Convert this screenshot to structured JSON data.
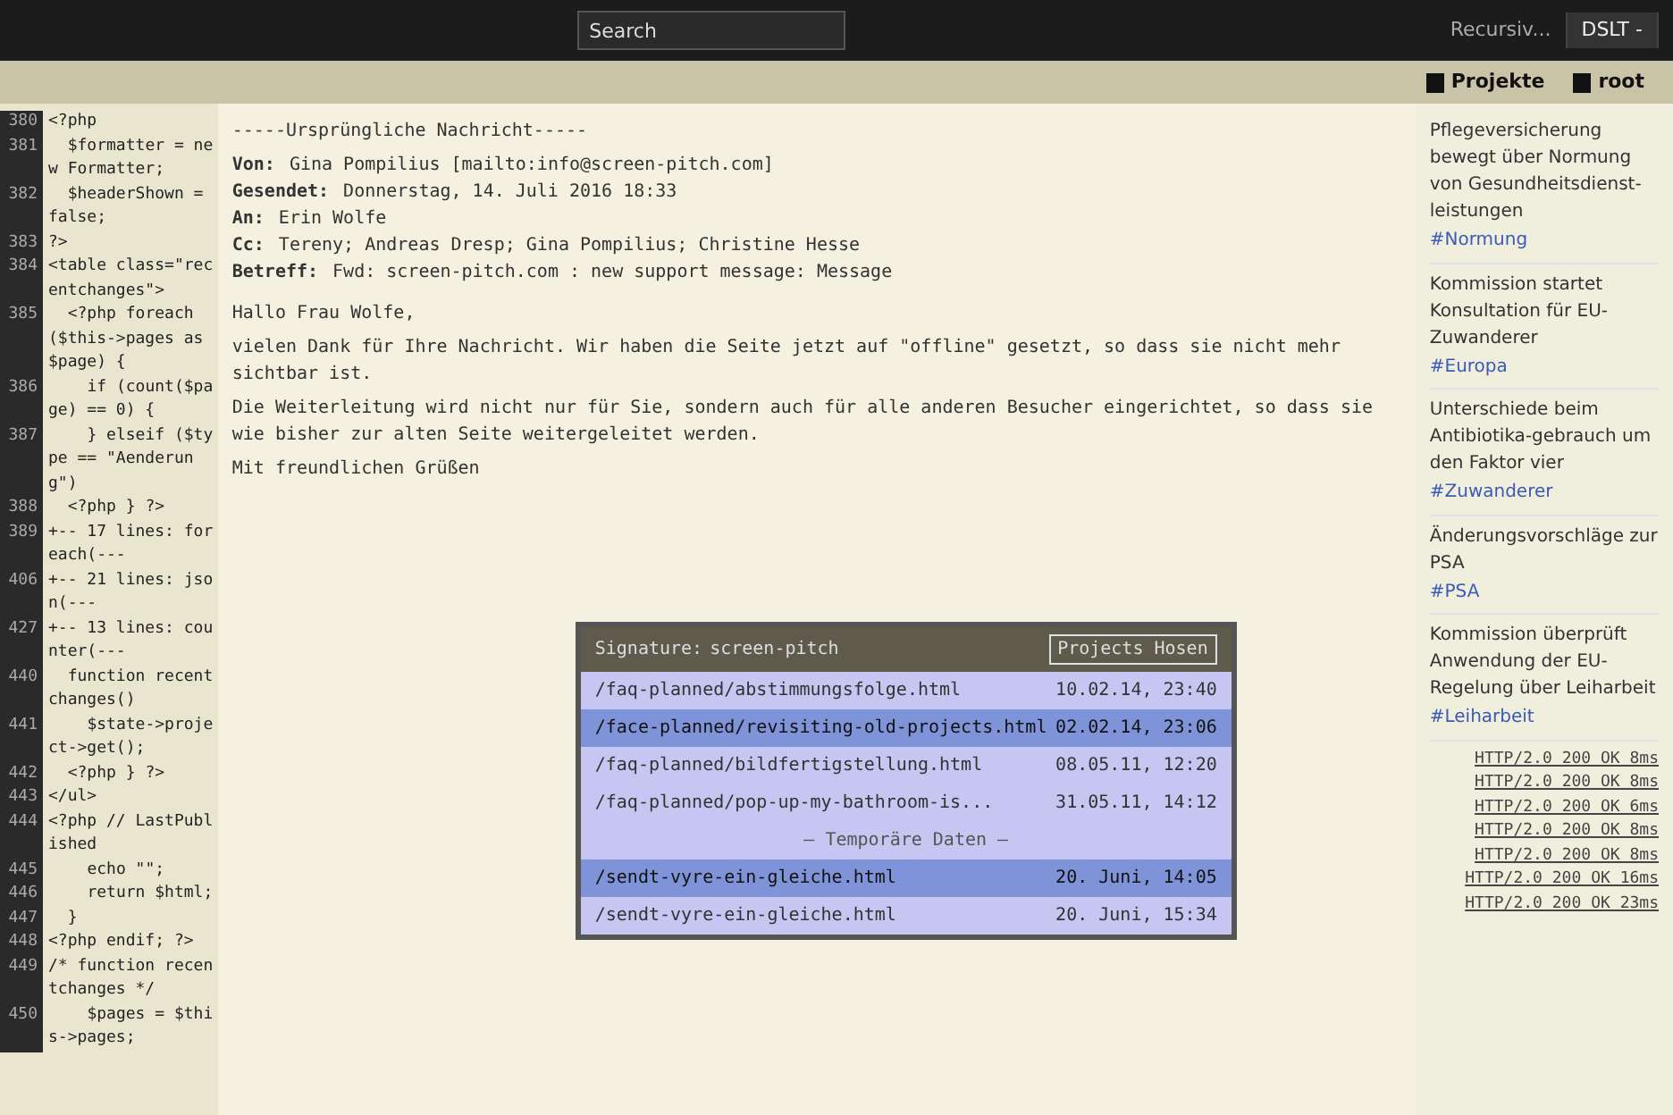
{
  "browser": {
    "tabs": [
      {
        "label": "Recursiv...",
        "selected": false
      },
      {
        "label": "DSLT -",
        "selected": true
      }
    ],
    "search": {
      "placeholder": "Search"
    },
    "bookmarks": [
      {
        "label": "Projekte"
      },
      {
        "label": "root"
      }
    ]
  },
  "code_editor": {
    "lines": [
      {
        "number": "380",
        "code": "<?php"
      },
      {
        "number": "381",
        "code": "  $formatter = new Formatter;"
      },
      {
        "number": "382",
        "code": "  $headerShown = false;"
      },
      {
        "number": "383",
        "code": "?>"
      },
      {
        "number": "384",
        "code": "<table class=\"recentchanges\">"
      },
      {
        "number": "385",
        "code": "  <?php foreach($this->pages as $page) {"
      },
      {
        "number": "386",
        "code": "    if (count($page) == 0) {"
      },
      {
        "number": "387",
        "code": "    } elseif ($type == \"Aenderung\")"
      },
      {
        "number": "388",
        "code": "  <?php } ?>"
      },
      {
        "number": "389",
        "code": "+-- 17 lines: foreach(---"
      },
      {
        "number": "406",
        "code": "+-- 21 lines: json(---"
      },
      {
        "number": "427",
        "code": "+-- 13 lines: counter(---"
      },
      {
        "number": "440",
        "code": "  function recentchanges()"
      },
      {
        "number": "441",
        "code": "    $state->project->get();"
      },
      {
        "number": "442",
        "code": "  <?php } ?>"
      },
      {
        "number": "443",
        "code": "</ul>"
      },
      {
        "number": "444",
        "code": "<?php // LastPublished"
      },
      {
        "number": "445",
        "code": "    echo \"\";"
      },
      {
        "number": "446",
        "code": "    return $html;"
      },
      {
        "number": "447",
        "code": "  }"
      },
      {
        "number": "448",
        "code": "<?php endif; ?>"
      },
      {
        "number": "449",
        "code": "/* function recentchanges */"
      },
      {
        "number": "450",
        "code": "    $pages = $this->pages;"
      }
    ]
  },
  "email": {
    "heading": "-----Ursprüngliche Nachricht-----",
    "fields": [
      {
        "label": "Von:",
        "value": "Gina Pompilius [mailto:info@screen-pitch.com]"
      },
      {
        "label": "Gesendet:",
        "value": "Donnerstag, 14. Juli 2016 18:33"
      },
      {
        "label": "An:",
        "value": "Erin Wolfe"
      },
      {
        "label": "Cc:",
        "value": "Tereny; Andreas Dresp; Gina Pompilius; Christine Hesse"
      },
      {
        "label": "Betreff:",
        "value": "Fwd: screen-pitch.com : new support message: Message"
      }
    ],
    "body": [
      "Hallo Frau Wolfe,",
      "vielen Dank für Ihre Nachricht. Wir haben die Seite jetzt auf \"offline\" gesetzt, so dass sie nicht mehr sichtbar ist.",
      "Die Weiterleitung wird nicht nur für Sie, sondern auch für alle anderen Besucher eingerichtet, so dass sie wie bisher zur alten Seite weitergeleitet werden.",
      "Mit freundlichen Grüßen"
    ]
  },
  "file_dialog": {
    "title": "Projects Hosen",
    "signature_label": "Signature:",
    "signature_value": "screen-pitch",
    "rows": [
      {
        "kind": "file",
        "path": "/faq-planned/abstimmungsfolge.html",
        "date": "10.02.14, 23:40",
        "selected": false
      },
      {
        "kind": "file",
        "path": "/face-planned/revisiting-old-projects.html",
        "date": "02.02.14, 23:06",
        "selected": true
      },
      {
        "kind": "file",
        "path": "/faq-planned/bildfertigstellung.html",
        "date": "08.05.11, 12:20",
        "selected": false
      },
      {
        "kind": "file",
        "path": "/faq-planned/pop-up-my-bathroom-is...",
        "date": "31.05.11, 14:12",
        "selected": false
      },
      {
        "kind": "separator",
        "path": "— Temporäre Daten —"
      },
      {
        "kind": "file",
        "path": "/sendt-vyre-ein-gleiche.html",
        "date": "20. Juni, 14:05",
        "selected": true
      },
      {
        "kind": "file",
        "path": "/sendt-vyre-ein-gleiche.html",
        "date": "20. Juni, 15:34",
        "selected": false
      }
    ]
  },
  "news": {
    "items": [
      {
        "text": "Pflegeversicherung bewegt über Normung von Gesundheitsdienst-leistungen",
        "tag": "#Normung"
      },
      {
        "text": "Kommission startet Konsultation für EU-Zuwanderer",
        "tag": "#Europa"
      },
      {
        "text": "Unterschiede beim Antibiotika-gebrauch um den Faktor vier",
        "tag": "#Zuwanderer"
      },
      {
        "text": "Änderungsvorschläge zur PSA",
        "tag": "#PSA"
      },
      {
        "text": "Kommission überprüft Anwendung der EU-Regelung über Leiharbeit",
        "tag": "#Leiharbeit"
      }
    ]
  },
  "log": [
    "HTTP/2.0 200 OK 8ms",
    "HTTP/2.0 200 OK 8ms",
    "HTTP/2.0 200 OK 6ms",
    "HTTP/2.0 200 OK 8ms",
    "HTTP/2.0 200 OK 8ms",
    "HTTP/2.0 200 OK 16ms",
    "HTTP/2.0 200 OK 23ms"
  ]
}
